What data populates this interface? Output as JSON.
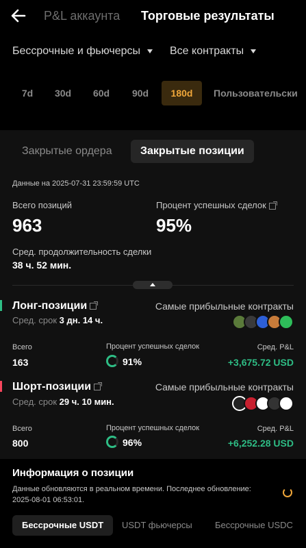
{
  "header": {
    "tab_pl": "P&L аккаунта",
    "tab_results": "Торговые результаты"
  },
  "filters": {
    "market": "Бессрочные и фьючерсы",
    "contracts": "Все контракты"
  },
  "periods": [
    "7d",
    "30d",
    "60d",
    "90d",
    "180d",
    "Пользовательски"
  ],
  "active_period": "180d",
  "tabs": {
    "closed_orders": "Закрытые ордера",
    "closed_positions": "Закрытые позиции"
  },
  "stamp": "Данные на 2025-07-31 23:59:59 UTC",
  "summary": {
    "total_label": "Всего позиций",
    "total_value": "963",
    "winrate_label": "Процент успешных сделок",
    "winrate_value": "95%",
    "duration_label": "Сред. продолжительность сделки",
    "duration_value": "38 ч. 52 мин."
  },
  "long": {
    "title": "Лонг-позиции",
    "term_label": "Сред. срок",
    "term_value": "3 дн. 14 ч.",
    "top_label": "Самые прибыльные контракты",
    "total_label": "Всего",
    "total_value": "163",
    "winrate_label": "Процент успешных сделок",
    "winrate_value": "91%",
    "pnl_label": "Сред. P&L",
    "pnl_value": "+3,675.72 USD"
  },
  "short": {
    "title": "Шорт-позиции",
    "term_label": "Сред. срок",
    "term_value": "29 ч. 10 мин.",
    "top_label": "Самые прибыльные контракты",
    "total_label": "Всего",
    "total_value": "800",
    "winrate_label": "Процент успешных сделок",
    "winrate_value": "96%",
    "pnl_label": "Сред. P&L",
    "pnl_value": "+6,252.28 USD"
  },
  "info": {
    "title": "Информация о позиции",
    "text": "Данные обновляются в реальном времени. Последнее обновление: 2025-08-01 06:53:01.",
    "tabs": [
      "Бессрочные USDT",
      "USDT фьючерсы",
      "Бессрочные USDC"
    ]
  },
  "colors": {
    "accent": "#f0a73a",
    "profit": "#2ebd85",
    "long_bar": "#2ebd85",
    "short_bar": "#f6465d"
  }
}
